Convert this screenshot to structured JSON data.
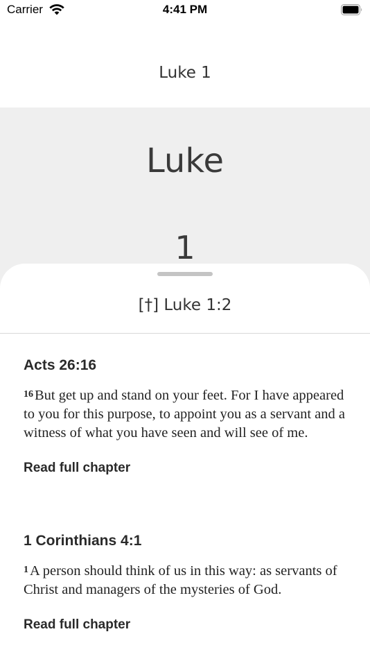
{
  "status_bar": {
    "carrier": "Carrier",
    "time": "4:41 PM"
  },
  "nav": {
    "title": "Luke 1"
  },
  "chapter_header": {
    "book": "Luke",
    "chapter": "1"
  },
  "sheet": {
    "title": "[†] Luke 1:2",
    "references": [
      {
        "reference": "Acts 26:16",
        "verse_number": "16",
        "text": "But get up and stand on your feet. For I have appeared to you for this purpose, to appoint you as a servant and a witness of what you have seen and will see of me.",
        "link_label": "Read full chapter"
      },
      {
        "reference": "1 Corinthians 4:1",
        "verse_number": "1",
        "text": "A person should think of us in this way: as servants of Christ and managers of the mysteries of God.",
        "link_label": "Read full chapter"
      }
    ]
  }
}
